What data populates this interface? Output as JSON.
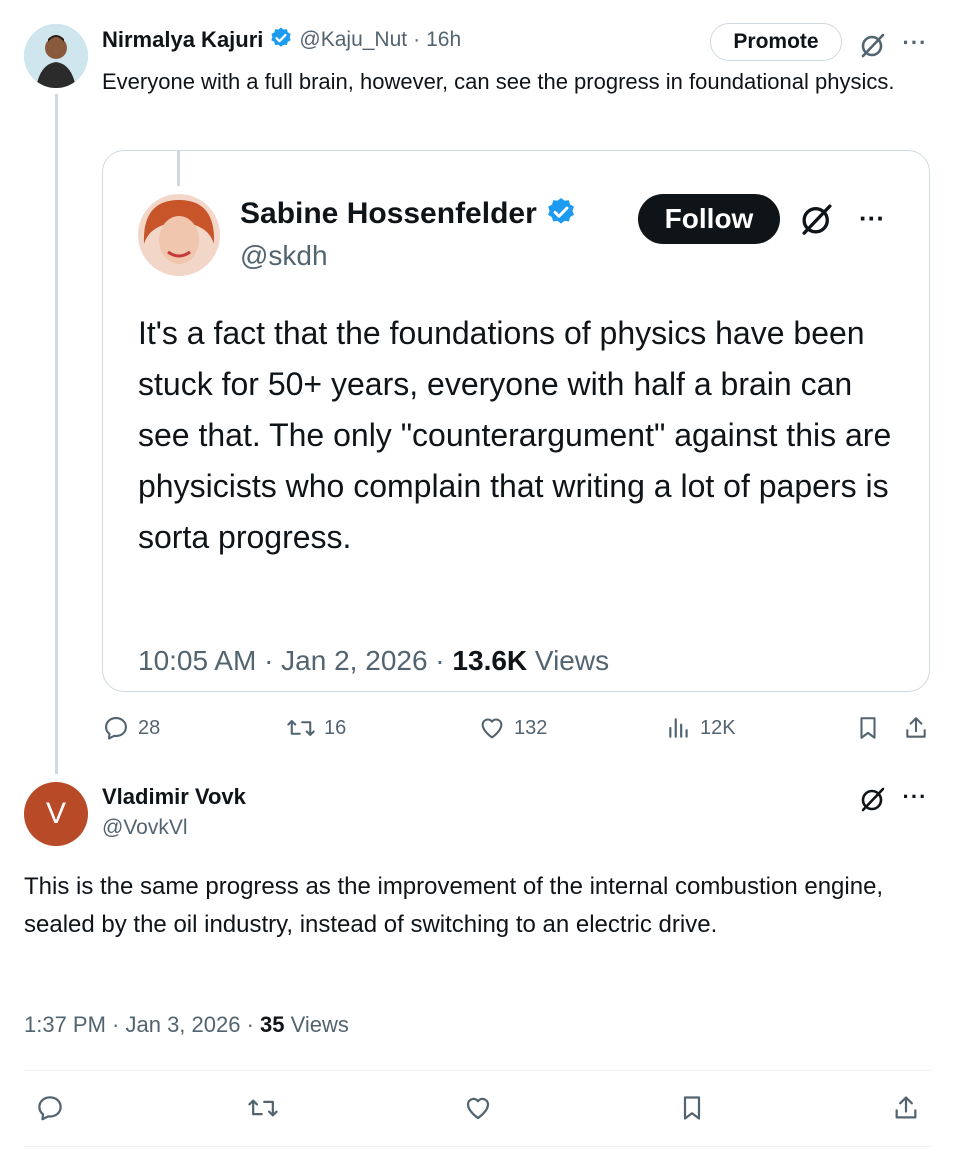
{
  "tweet": {
    "author_name": "Nirmalya Kajuri",
    "author_handle": "@Kaju_Nut",
    "separator": "·",
    "time": "16h",
    "promote_label": "Promote",
    "text": "Everyone with a full brain, however, can see the progress in foundational physics.",
    "actions": {
      "replies": "28",
      "reposts": "16",
      "likes": "132",
      "views": "12K"
    }
  },
  "quote": {
    "author_name": "Sabine Hossenfelder",
    "author_handle": "@skdh",
    "follow_label": "Follow",
    "text": "It's a fact that the foundations of physics have been stuck for 50+ years, everyone with half a brain can see that. The only \"counterargument\" against this are physicists who complain that writing a lot of papers is sorta progress.",
    "timestamp": "10:05 AM · Jan 2, 2026 · ",
    "views_count": "13.6K",
    "views_label": " Views"
  },
  "reply": {
    "avatar_letter": "V",
    "author_name": "Vladimir Vovk",
    "author_handle": "@VovkVl",
    "text": "This is the same progress as the improvement of the internal combustion engine, sealed by the oil industry, instead of switching to an electric drive.",
    "timestamp": "1:37 PM · Jan 3, 2026 · ",
    "views_count": "35",
    "views_label": " Views"
  },
  "colors": {
    "verified": "#1d9bf0",
    "text": "#0f1419",
    "muted": "#536471",
    "reply_avatar": "#b84a28"
  },
  "icons": [
    "verified-badge-icon",
    "grok-icon",
    "more-icon",
    "reply-icon",
    "repost-icon",
    "like-icon",
    "views-icon",
    "bookmark-icon",
    "share-icon"
  ]
}
